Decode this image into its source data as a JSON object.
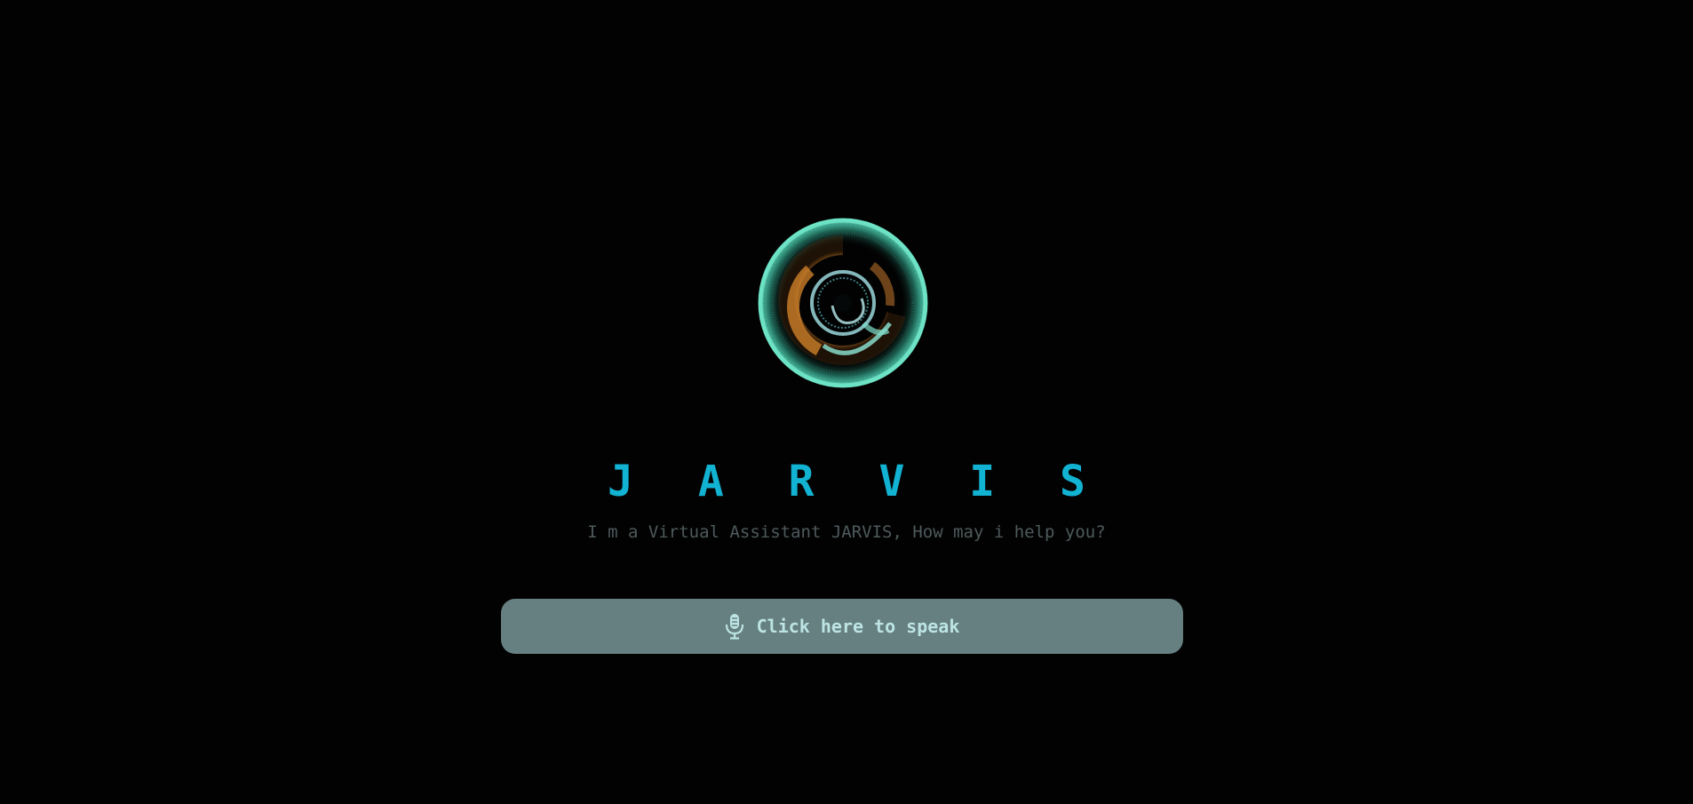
{
  "app": {
    "title": "J A R V I S",
    "subtitle": "I m a Virtual Assistant JARVIS, How may i help you?"
  },
  "speak_button": {
    "label": "Click here to speak",
    "icon": "microphone-icon"
  },
  "colors": {
    "background": "#020202",
    "title": "#12b3d2",
    "subtitle": "#4e5a5c",
    "button_bg": "#667f80",
    "button_text": "#bde4e4",
    "orb_ring": "#5fe3c2",
    "orb_core": "#d9882c"
  }
}
